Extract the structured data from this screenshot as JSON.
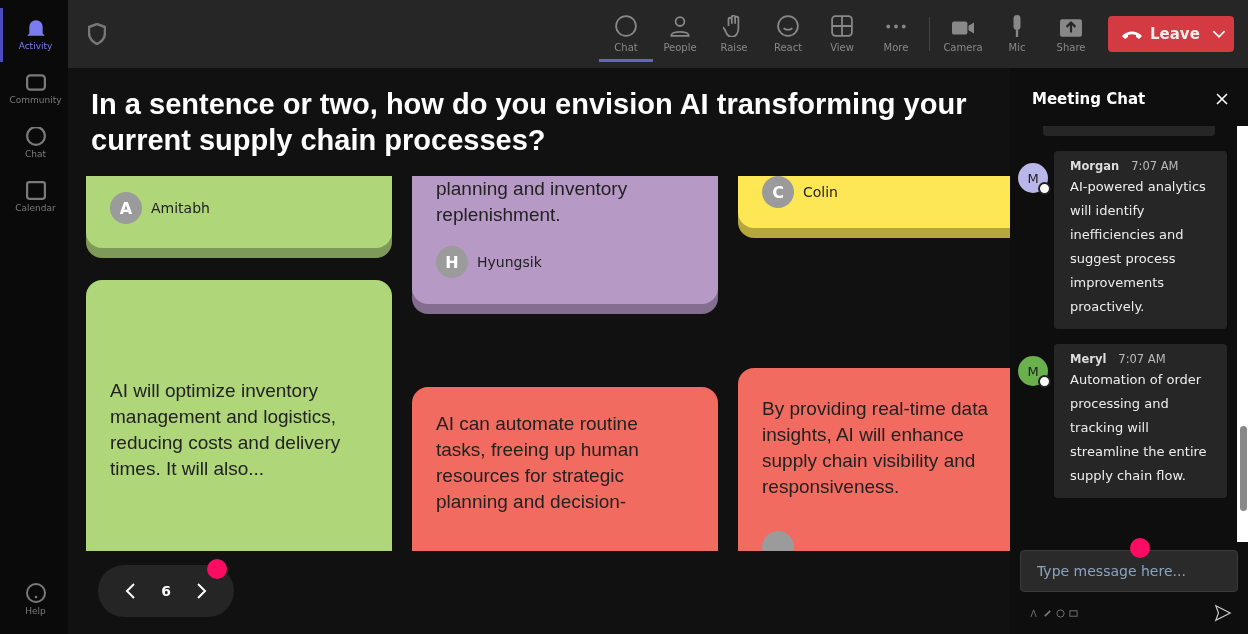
{
  "rail": {
    "items": [
      {
        "label": "Activity",
        "selected": true
      },
      {
        "label": "Community",
        "selected": false
      },
      {
        "label": "Chat",
        "selected": false
      },
      {
        "label": "Calendar",
        "selected": false
      }
    ],
    "help": {
      "label": "Help"
    }
  },
  "toolbar": {
    "items": [
      {
        "label": "Chat",
        "selected": true
      },
      {
        "label": "People",
        "selected": false
      },
      {
        "label": "Raise",
        "selected": false
      },
      {
        "label": "React",
        "selected": false
      },
      {
        "label": "View",
        "selected": false
      },
      {
        "label": "More",
        "selected": false
      }
    ],
    "media": [
      {
        "label": "Camera"
      },
      {
        "label": "Mic"
      },
      {
        "label": "Share"
      }
    ],
    "leave": "Leave"
  },
  "question": "In a sentence or two, how do you envision AI transforming your current supply chain processes?",
  "board": {
    "columns": [
      [
        {
          "text": "",
          "author": "Amitabh",
          "initial": "A",
          "color": "#b0d67a"
        },
        {
          "text": "AI will optimize inventory management and logistics, reducing costs and delivery times. It will also...",
          "color": "#b0d67a"
        }
      ],
      [
        {
          "text": "planning and inventory replenishment.",
          "author": "Hyungsik",
          "initial": "H",
          "color": "#b799c6"
        },
        {
          "text": "AI can automate routine tasks, freeing up human resources for strategic planning and decision-",
          "color": "#f26b60"
        }
      ],
      [
        {
          "text": "",
          "author": "Colin",
          "initial": "C",
          "color": "#fee754"
        },
        {
          "text": "By providing real-time data insights, AI will enhance supply chain visibility and responsiveness.",
          "color": "#f26b60"
        }
      ]
    ]
  },
  "pager": {
    "page": "6"
  },
  "chat": {
    "title": "Meeting Chat",
    "messages": [
      {
        "name": "Morgan",
        "time": "7:07 AM",
        "initial": "M",
        "color": "#b9b6ea",
        "text": "AI-powered analytics will identify inefficiencies and suggest process improvements proactively."
      },
      {
        "name": "Meryl",
        "time": "7:07 AM",
        "initial": "M",
        "color": "#6ab04c",
        "text": "Automation of order processing and tracking will streamline the entire supply chain flow."
      }
    ],
    "placeholder": "Type message here..."
  }
}
